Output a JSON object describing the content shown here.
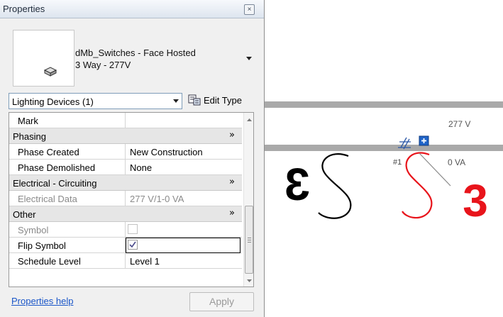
{
  "palette": {
    "title": "Properties",
    "type_selector": {
      "family": "dMb_Switches - Face Hosted",
      "type": "3 Way - 277V"
    },
    "filter": {
      "value": "Lighting Devices (1)"
    },
    "edit_type_label": "Edit Type",
    "rows": [
      {
        "kind": "param",
        "key": "Mark",
        "value": ""
      },
      {
        "kind": "group",
        "key": "Phasing"
      },
      {
        "kind": "param",
        "key": "Phase Created",
        "value": "New Construction"
      },
      {
        "kind": "param",
        "key": "Phase Demolished",
        "value": "None"
      },
      {
        "kind": "group",
        "key": "Electrical - Circuiting"
      },
      {
        "kind": "param",
        "key": "Electrical Data",
        "value": "277 V/1-0 VA",
        "disabled": true
      },
      {
        "kind": "group",
        "key": "Other"
      },
      {
        "kind": "param",
        "key": "Symbol",
        "checkbox": false,
        "disabled": true
      },
      {
        "kind": "param",
        "key": "Flip Symbol",
        "checkbox": true
      },
      {
        "kind": "param",
        "key": "Schedule Level",
        "value": "Level 1"
      }
    ],
    "help_link": "Properties help",
    "apply_label": "Apply"
  },
  "canvas": {
    "voltage_label": "277 V",
    "circuit_label": "#1",
    "va_label": "0 VA",
    "left_switch_tag": "3",
    "right_switch_tag": "3",
    "colors": {
      "selected": "#e8141b",
      "normal": "#000000",
      "wall": "#a9a9a9"
    }
  }
}
